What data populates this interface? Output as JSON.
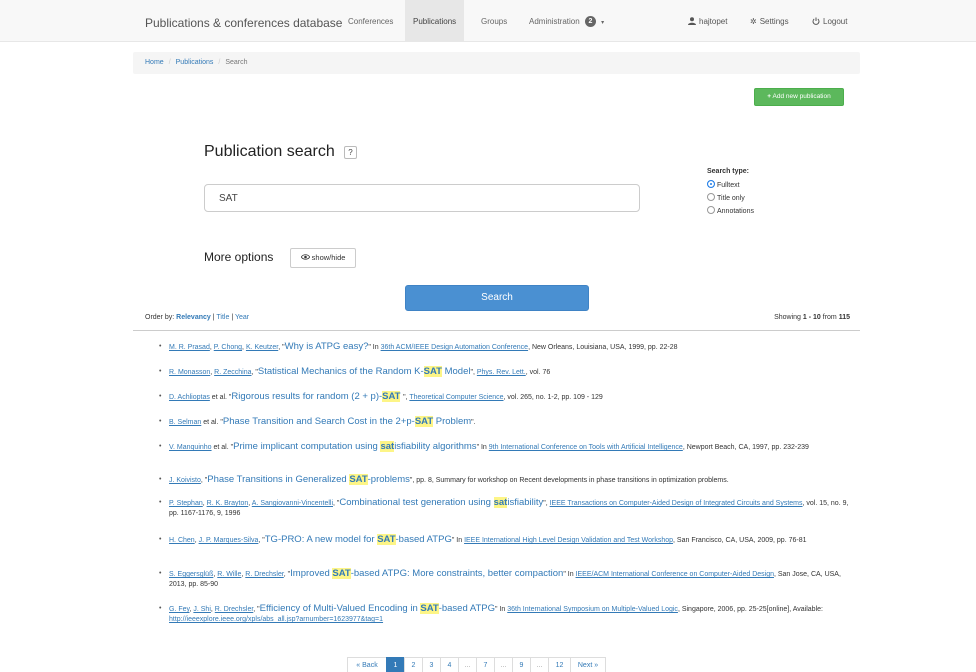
{
  "navbar": {
    "brand": "Publications & conferences database",
    "items": [
      {
        "label": "Conferences"
      },
      {
        "label": "Publications"
      },
      {
        "label": "Groups"
      },
      {
        "label": "Administration"
      }
    ],
    "admin_badge": "2",
    "user": "hajtopet",
    "settings": "Settings",
    "logout": "Logout"
  },
  "breadcrumb": [
    "Home",
    "Publications",
    "Search"
  ],
  "add_button": "Add new publication",
  "search": {
    "title": "Publication search",
    "help": "?",
    "value": "SAT",
    "type_label": "Search type:",
    "types": [
      {
        "label": "Fulltext",
        "checked": true
      },
      {
        "label": "Title only",
        "checked": false
      },
      {
        "label": "Annotations",
        "checked": false
      }
    ],
    "more_options": "More options",
    "show_hide": "show/hide",
    "button": "Search"
  },
  "order": {
    "label": "Order by:",
    "relevancy": "Relevancy",
    "title": "Title",
    "year": "Year",
    "sep": "|"
  },
  "showing": {
    "prefix": "Showing",
    "range": "1 - 10",
    "middle": "from",
    "total": "115"
  },
  "results": [
    {
      "html": "<a>M. R. Prasad</a>, <a>P. Chong</a>, <a>K. Keutzer</a>, \"<span class='title'>Why is ATPG easy?</span>\" In <a>36th ACM/IEEE Design Automation Conference</a>, New Orleans, Louisiana, USA, 1999, pp. 22-28"
    },
    {
      "html": "<a>R. Monasson</a>, <a>R. Zecchina</a>, \"<span class='title'>Statistical Mechanics of the Random K-<span class='hl'>SAT</span> Model</span>\", <a>Phys. Rev. Lett.</a>, vol. 76"
    },
    {
      "html": "<a>D. Achlioptas</a> et al. \"<span class='title'>Rigorous results for random (2 + p)-<span class='hl'>SAT</span> </span>\", <a>Theoretical Computer Science</a>, vol. 265, no. 1-2, pp. 109 - 129"
    },
    {
      "html": "<a>B. Selman</a> et al. \"<span class='title'>Phase Transition and Search Cost in the 2+p-<span class='hl'>SAT</span> Problem</span>\"."
    },
    {
      "html": "<a>V. Manquinho</a> et al. \"<span class='title'>Prime implicant computation using <span class='hl'>sat</span>isfiability algorithms</span>\" In <a>9th International Conference on Tools with Artificial Intelligence</a>, Newport Beach, CA, 1997, pp. 232-239"
    },
    {
      "html": "<a>J. Koivisto</a>, \"<span class='title'>Phase Transitions in Generalized <span class='hl'>SAT</span>-problems</span>\", pp. 8, Summary for workshop on Recent developments in phase transitions in optimization problems."
    },
    {
      "html": "<a>P. Stephan</a>, <a>R. K. Brayton</a>, <a>A. Sangiovanni-Vincentelli</a>, \"<span class='title'>Combinational test generation using <span class='hl'>sat</span>isfiability</span>\", <a>IEEE Transactions on Computer-Aided Design of Integrated Circuits and Systems</a>, vol. 15, no. 9, pp. 1167-1176, 9, 1996"
    },
    {
      "html": "<a>H. Chen</a>, <a>J. P. Marques-Silva</a>, \"<span class='title'>TG-PRO: A new model for <span class='hl'>SAT</span>-based ATPG</span>\" In <a>IEEE International High Level Design Validation and Test Workshop</a>, San Francisco, CA, USA, 2009, pp. 76-81"
    },
    {
      "html": "<a>S. Eggersgl&uuml;&szlig;</a>, <a>R. Wille</a>, <a>R. Drechsler</a>, \"<span class='title'>Improved <span class='hl'>SAT</span>-based ATPG: More constraints, better compaction</span>\" In <a>IEEE/ACM International Conference on Computer-Aided Design</a>, San Jose, CA, USA, 2013, pp. 85-90"
    },
    {
      "html": "<a>G. Fey</a>, <a>J. Shi</a>, <a>R. Drechsler</a>, \"<span class='title'>Efficiency of Multi-Valued Encoding in <span class='hl'>SAT</span>-based ATPG</span>\" In <a>36th International Symposium on Multiple-Valued Logic</a>, Singapore, 2006, pp. 25-25[online], Available: <a>http://ieeexplore.ieee.org/xpls/abs_all.jsp?arnumber=1623977&amp;tag=1</a>"
    }
  ],
  "pagination": [
    {
      "label": "« Back",
      "active": false,
      "dots": false
    },
    {
      "label": "1",
      "active": true,
      "dots": false
    },
    {
      "label": "2",
      "active": false,
      "dots": false
    },
    {
      "label": "3",
      "active": false,
      "dots": false
    },
    {
      "label": "4",
      "active": false,
      "dots": false
    },
    {
      "label": "...",
      "active": false,
      "dots": true
    },
    {
      "label": "7",
      "active": false,
      "dots": false
    },
    {
      "label": "...",
      "active": false,
      "dots": true
    },
    {
      "label": "9",
      "active": false,
      "dots": false
    },
    {
      "label": "...",
      "active": false,
      "dots": true
    },
    {
      "label": "12",
      "active": false,
      "dots": false
    },
    {
      "label": "Next »",
      "active": false,
      "dots": false
    }
  ],
  "icons": {
    "user": "user-icon",
    "settings": "gear-icon",
    "logout": "power-icon",
    "add": "plus-icon",
    "eye": "eye-icon"
  },
  "colors": {
    "primary": "#337ab7",
    "success": "#5cb85c",
    "search_button": "#4a90d2",
    "highlight": "#fdf587"
  }
}
